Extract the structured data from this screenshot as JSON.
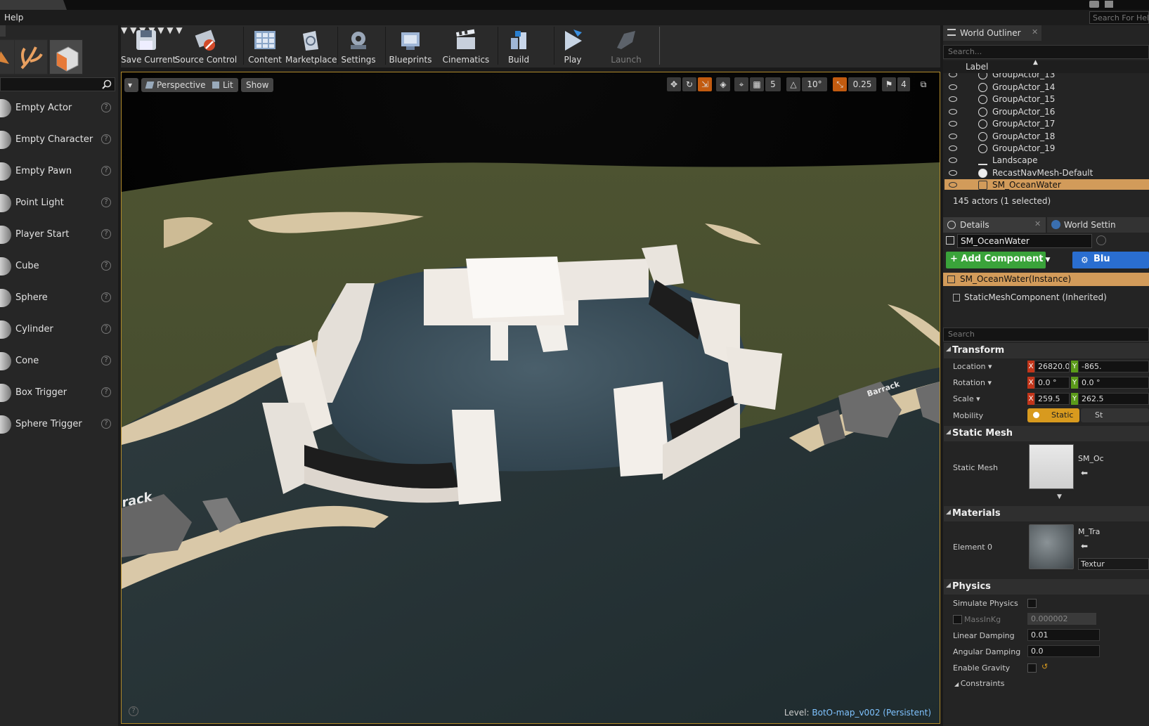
{
  "menu": {
    "help": "Help"
  },
  "search_help": {
    "placeholder": "Search For Help"
  },
  "place_items": [
    {
      "label": "Empty Actor"
    },
    {
      "label": "Empty Character"
    },
    {
      "label": "Empty Pawn"
    },
    {
      "label": "Point Light"
    },
    {
      "label": "Player Start"
    },
    {
      "label": "Cube"
    },
    {
      "label": "Sphere"
    },
    {
      "label": "Cylinder"
    },
    {
      "label": "Cone"
    },
    {
      "label": "Box Trigger"
    },
    {
      "label": "Sphere Trigger"
    }
  ],
  "toolbar": {
    "save_current": "Save Current",
    "source_control": "Source Control",
    "content": "Content",
    "marketplace": "Marketplace",
    "settings": "Settings",
    "blueprints": "Blueprints",
    "cinematics": "Cinematics",
    "build": "Build",
    "play": "Play",
    "launch": "Launch"
  },
  "viewport": {
    "perspective": "Perspective",
    "lit": "Lit",
    "show": "Show",
    "grid_snap": "5",
    "rot_snap": "10°",
    "scale_snap": "0.25",
    "cam_speed": "4",
    "level_label": "Level:",
    "level_name": "BotO-map_v002 (Persistent)",
    "label_track": "rack",
    "label_barrack": "Barrack"
  },
  "outliner": {
    "tab": "World Outliner",
    "search_placeholder": "Search...",
    "col_label": "Label",
    "rows": [
      {
        "name": "GroupActor_13"
      },
      {
        "name": "GroupActor_14"
      },
      {
        "name": "GroupActor_15"
      },
      {
        "name": "GroupActor_16"
      },
      {
        "name": "GroupActor_17"
      },
      {
        "name": "GroupActor_18"
      },
      {
        "name": "GroupActor_19"
      },
      {
        "name": "Landscape"
      },
      {
        "name": "RecastNavMesh-Default"
      },
      {
        "name": "SM_OceanWater",
        "selected": true
      }
    ],
    "status": "145 actors (1 selected)"
  },
  "details": {
    "tab": "Details",
    "tab2": "World Settin",
    "actor_name": "SM_OceanWater",
    "add_component": "+ Add Component",
    "blueprint_btn": "Blu",
    "instance": "SM_OceanWater(Instance)",
    "component": "StaticMeshComponent (Inherited)",
    "search_placeholder": "Search",
    "transform": {
      "title": "Transform",
      "location": "Location",
      "rotation": "Rotation",
      "scale": "Scale",
      "mobility": "Mobility",
      "loc_x": "26820.0",
      "loc_y": "-865.",
      "rot_x": "0.0 °",
      "rot_y": "0.0 °",
      "scale_x": "259.5",
      "scale_y": "262.5",
      "mobility_static": "Static",
      "mobility_st": "St",
      "x": "X",
      "y": "Y"
    },
    "static_mesh": {
      "title": "Static Mesh",
      "label": "Static Mesh",
      "asset": "SM_Oc"
    },
    "materials": {
      "title": "Materials",
      "element0": "Element 0",
      "asset": "M_Tra",
      "texture": "Textur"
    },
    "physics": {
      "title": "Physics",
      "simulate": "Simulate Physics",
      "mass": "MassInKg",
      "mass_val": "0.000002",
      "linear": "Linear Damping",
      "linear_val": "0.01",
      "angular": "Angular Damping",
      "angular_val": "0.0",
      "gravity": "Enable Gravity",
      "constraints": "Constraints"
    }
  },
  "colors": {
    "accent": "#b08a2a",
    "selection": "#d29b5a",
    "add_component": "#3aa33a",
    "blueprint": "#2a6ed0"
  }
}
